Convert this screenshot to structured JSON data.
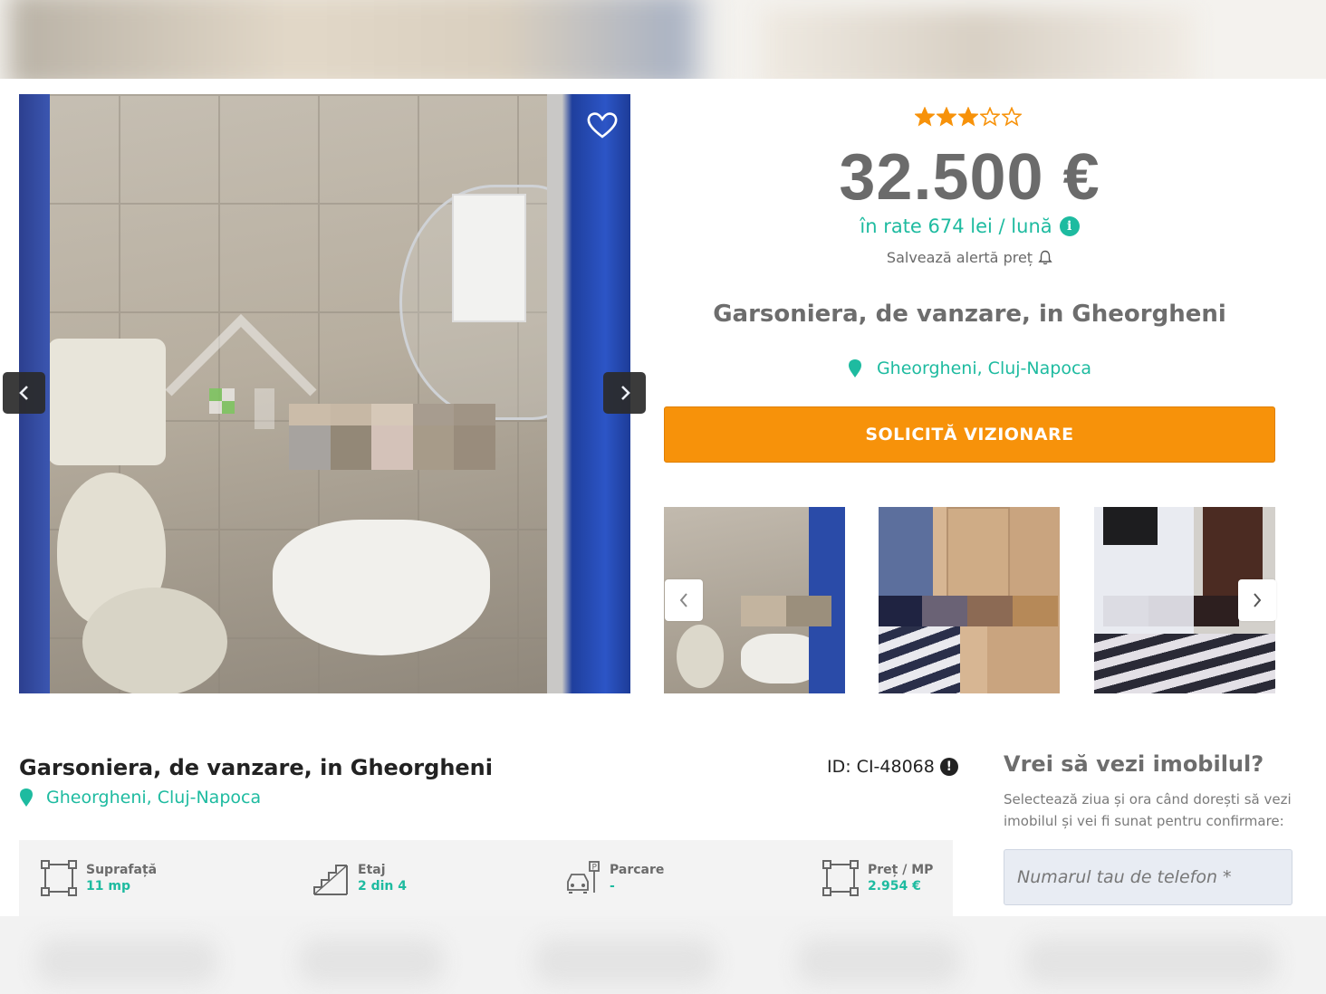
{
  "gallery": {
    "favorite_icon": "heart-outline-icon",
    "prev_icon": "chevron-left-icon",
    "next_icon": "chevron-right-icon",
    "thumbnails": [
      "thumb-bathroom",
      "thumb-hallway",
      "thumb-room"
    ]
  },
  "summary": {
    "rating": 3,
    "rating_max": 5,
    "price": "32.500 €",
    "installment": "în rate 674 lei / lună",
    "price_alert": "Salvează alertă preț",
    "title": "Garsoniera, de vanzare, in Gheorgheni",
    "location": "Gheorgheni, Cluj-Napoca",
    "cta": "SOLICITĂ VIZIONARE"
  },
  "details": {
    "title": "Garsoniera, de vanzare, in Gheorgheni",
    "location": "Gheorgheni, Cluj-Napoca",
    "id_label": "ID: CI-48068",
    "features": [
      {
        "label": "Suprafață",
        "value": "11 mp",
        "icon": "area-icon"
      },
      {
        "label": "Etaj",
        "value": "2 din 4",
        "icon": "stairs-icon"
      },
      {
        "label": "Parcare",
        "value": "-",
        "icon": "parking-icon"
      },
      {
        "label": "Preț / MP",
        "value": "2.954 €",
        "icon": "area-icon"
      }
    ]
  },
  "viewing": {
    "title": "Vrei să vezi imobilul?",
    "description": "Selectează ziua și ora când dorești să vezi imobilul și vei fi sunat pentru confirmare:",
    "phone_placeholder": "Numarul tau de telefon *"
  },
  "colors": {
    "accent": "#1ebba0",
    "cta": "#f7920a",
    "star": "#f7920a"
  }
}
